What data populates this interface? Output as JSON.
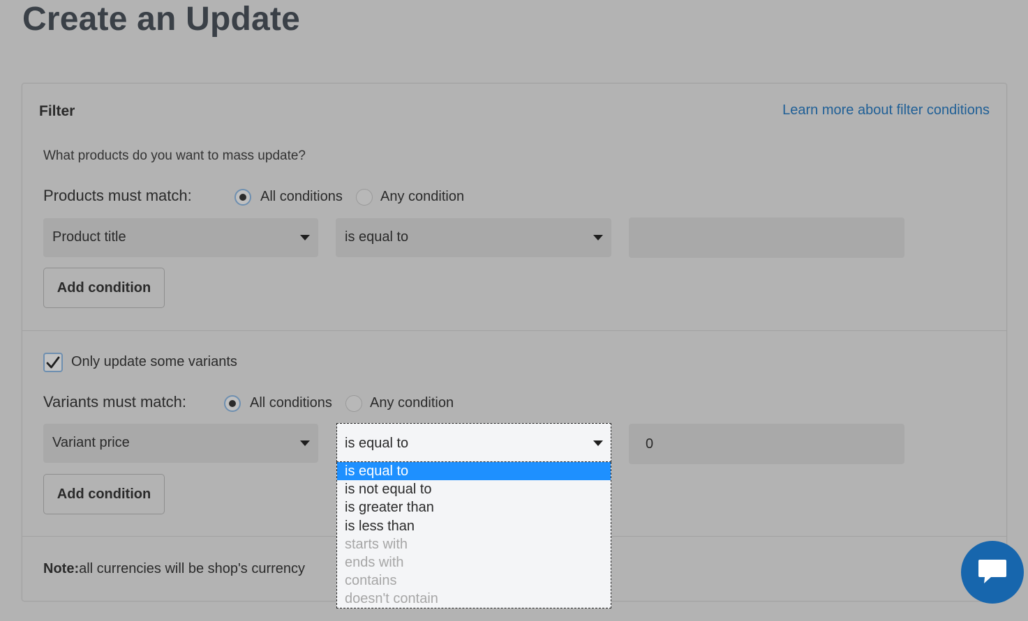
{
  "page": {
    "title": "Create an Update"
  },
  "filter": {
    "title": "Filter",
    "learn_more": "Learn more about filter conditions",
    "question": "What products do you want to mass update?",
    "products": {
      "match_label": "Products must match:",
      "all_label": "All conditions",
      "any_label": "Any condition",
      "field": "Product title",
      "operator": "is equal to",
      "value": "",
      "add_condition": "Add condition"
    },
    "variants": {
      "checkbox_label": "Only update some variants",
      "match_label": "Variants must match:",
      "all_label": "All conditions",
      "any_label": "Any condition",
      "field": "Variant price",
      "operator": "is equal to",
      "value": "0",
      "add_condition": "Add condition"
    },
    "note_bold": "Note:",
    "note_text": "all currencies will be shop's currency"
  },
  "dropdown": {
    "options": [
      {
        "label": "is equal to"
      },
      {
        "label": "is not equal to"
      },
      {
        "label": "is greater than"
      },
      {
        "label": "is less than"
      },
      {
        "label": "starts with"
      },
      {
        "label": "ends with"
      },
      {
        "label": "contains"
      },
      {
        "label": "doesn't contain"
      }
    ]
  },
  "colors": {
    "overlay_background": "#b3b3b3",
    "link": "#1f5f96",
    "selected_option": "#1e90ff",
    "chat_button": "#1766ad"
  },
  "icons": {
    "chat": "chat-icon",
    "check": "checkmark-icon",
    "caret": "caret-down-icon"
  }
}
